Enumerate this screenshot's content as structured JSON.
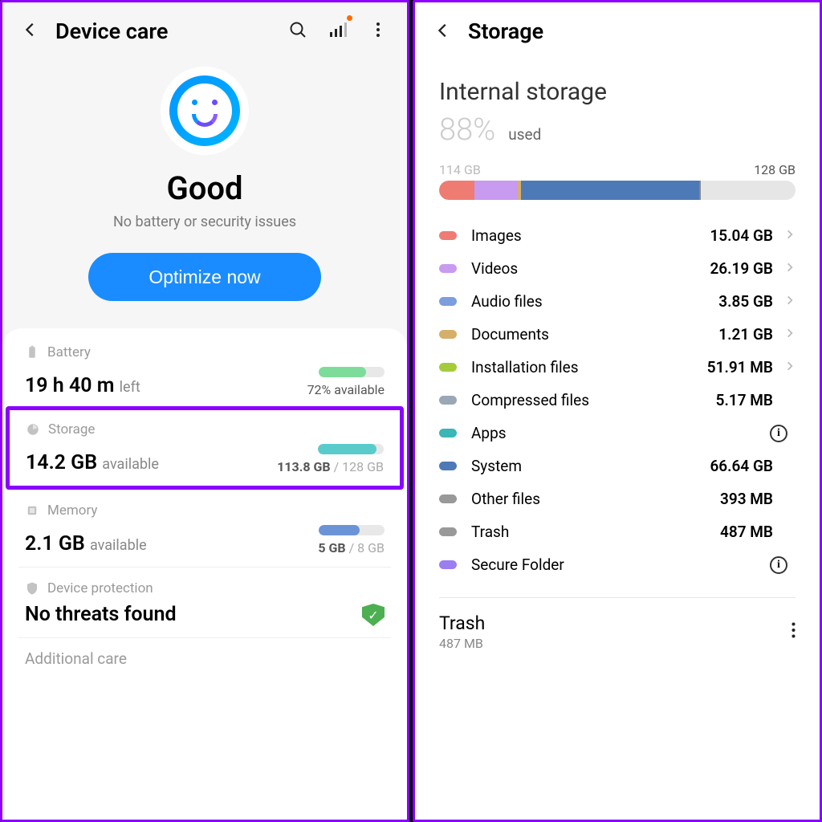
{
  "left": {
    "title": "Device care",
    "status": "Good",
    "subtitle": "No battery or security issues",
    "optimize_btn": "Optimize now",
    "battery": {
      "label": "Battery",
      "value": "19 h 40 m",
      "value_suffix": "left",
      "pct_label": "72% available",
      "pct": 72,
      "bar_color": "#7edc9a"
    },
    "storage": {
      "label": "Storage",
      "value": "14.2 GB",
      "value_suffix": "available",
      "used_label": "113.8 GB",
      "total_label": "/ 128 GB",
      "pct": 89,
      "bar_color": "#5acbcb"
    },
    "memory": {
      "label": "Memory",
      "value": "2.1 GB",
      "value_suffix": "available",
      "used_label": "5 GB",
      "total_label": "/ 8 GB",
      "pct": 62,
      "bar_color": "#6b94d6"
    },
    "protection": {
      "label": "Device protection",
      "value": "No threats found"
    },
    "additional": "Additional care"
  },
  "right": {
    "title": "Storage",
    "section": "Internal storage",
    "pct": "88%",
    "used_label": "used",
    "left_label": "114 GB",
    "right_label": "128 GB",
    "bar_segments": [
      {
        "color": "#ee7c72",
        "w": 10
      },
      {
        "color": "#c89af0",
        "w": 12
      },
      {
        "color": "#d6b06a",
        "w": 1
      },
      {
        "color": "#4d79b6",
        "w": 50
      },
      {
        "color": "#888",
        "w": 0.5
      }
    ],
    "categories": [
      {
        "name": "Images",
        "value": "15.04 GB",
        "color": "#ee7c72",
        "chevron": true
      },
      {
        "name": "Videos",
        "value": "26.19 GB",
        "color": "#c89af0",
        "chevron": true
      },
      {
        "name": "Audio files",
        "value": "3.85 GB",
        "color": "#7d9ede",
        "chevron": true
      },
      {
        "name": "Documents",
        "value": "1.21 GB",
        "color": "#d6b06a",
        "chevron": true
      },
      {
        "name": "Installation files",
        "value": "51.91 MB",
        "color": "#a4cc3a",
        "chevron": true
      },
      {
        "name": "Compressed files",
        "value": "5.17 MB",
        "color": "#9aa7b5",
        "chevron": false
      },
      {
        "name": "Apps",
        "value": "",
        "color": "#3bb5b5",
        "info": true
      },
      {
        "name": "System",
        "value": "66.64 GB",
        "color": "#4d79b6",
        "chevron": false
      },
      {
        "name": "Other files",
        "value": "393 MB",
        "color": "#999",
        "chevron": false
      },
      {
        "name": "Trash",
        "value": "487 MB",
        "color": "#999",
        "chevron": false
      },
      {
        "name": "Secure Folder",
        "value": "",
        "color": "#9b7ef0",
        "info": true
      }
    ],
    "trash": {
      "title": "Trash",
      "sub": "487 MB"
    }
  }
}
